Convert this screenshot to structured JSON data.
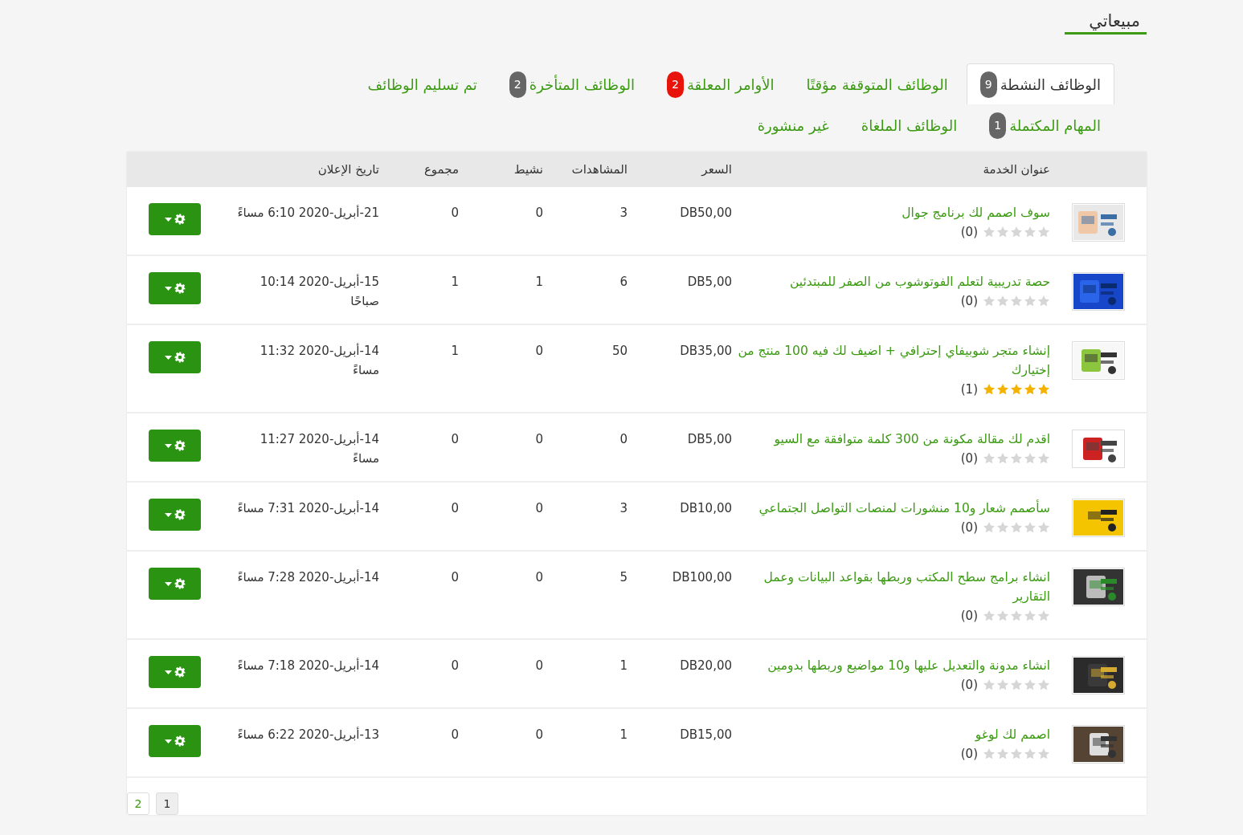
{
  "page_title": "مبيعاتي",
  "tab_rows": [
    [
      {
        "label": "الوظائف النشطة",
        "badge": {
          "text": "9",
          "color": "#666666"
        },
        "selected": true
      },
      {
        "label": "الوظائف المتوقفة مؤقتًا",
        "selected": false
      },
      {
        "label": "الأوامر المعلقة",
        "badge": {
          "text": "2",
          "color": "#e8140c"
        },
        "selected": false
      },
      {
        "label": "الوظائف المتأخرة",
        "badge": {
          "text": "2",
          "color": "#666666"
        },
        "selected": false
      },
      {
        "label": "تم تسليم الوظائف",
        "selected": false
      }
    ],
    [
      {
        "label": "المهام المكتملة",
        "badge": {
          "text": "1",
          "color": "#666666"
        },
        "selected": false
      },
      {
        "label": "الوظائف الملغاة",
        "selected": false
      },
      {
        "label": "غير منشورة",
        "selected": false
      }
    ]
  ],
  "table": {
    "columns": [
      "عنوان الخدمة",
      "السعر",
      "المشاهدات",
      "نشيط",
      "مجموع",
      "تاريخ الإعلان"
    ],
    "rows": [
      {
        "title": "سوف اصمم لك برنامج جوال",
        "stars": 0,
        "reviews": "(0)",
        "price": "DB50,00",
        "views": "3",
        "active": "0",
        "total": "0",
        "date": "21-أبريل-2020 6:10 مساءً"
      },
      {
        "title": "حصة تدريبية لتعلم الفوتوشوب من الصفر للمبتدئين",
        "stars": 0,
        "reviews": "(0)",
        "price": "DB5,00",
        "views": "6",
        "active": "1",
        "total": "1",
        "date": "15-أبريل-2020 10:14 صباحًا"
      },
      {
        "title": "إنشاء متجر شوبيفاي إحترافي + اضيف لك فيه 100 منتج من إختيارك",
        "stars": 5,
        "reviews": "(1)",
        "price": "DB35,00",
        "views": "50",
        "active": "0",
        "total": "1",
        "date": "14-أبريل-2020 11:32 مساءً"
      },
      {
        "title": "اقدم لك مقالة مكونة من 300 كلمة متوافقة مع السيو",
        "stars": 0,
        "reviews": "(0)",
        "price": "DB5,00",
        "views": "0",
        "active": "0",
        "total": "0",
        "date": "14-أبريل-2020 11:27 مساءً"
      },
      {
        "title": "سأصمم شعار و10 منشورات لمنصات التواصل الجتماعي",
        "stars": 0,
        "reviews": "(0)",
        "price": "DB10,00",
        "views": "3",
        "active": "0",
        "total": "0",
        "date": "14-أبريل-2020 7:31 مساءً"
      },
      {
        "title": "انشاء برامج سطح المكتب وربطها بقواعد البيانات وعمل التقارير",
        "stars": 0,
        "reviews": "(0)",
        "price": "DB100,00",
        "views": "5",
        "active": "0",
        "total": "0",
        "date": "14-أبريل-2020 7:28 مساءً"
      },
      {
        "title": "انشاء مدونة والتعديل عليها و10 مواضيع وربطها بدومين",
        "stars": 0,
        "reviews": "(0)",
        "price": "DB20,00",
        "views": "1",
        "active": "0",
        "total": "0",
        "date": "14-أبريل-2020 7:18 مساءً"
      },
      {
        "title": "اصمم لك لوغو",
        "stars": 0,
        "reviews": "(0)",
        "price": "DB15,00",
        "views": "1",
        "active": "0",
        "total": "0",
        "date": "13-أبريل-2020 6:22 مساءً"
      }
    ]
  },
  "pagination": [
    {
      "label": "1",
      "selected": true
    },
    {
      "label": "2",
      "selected": false
    }
  ]
}
